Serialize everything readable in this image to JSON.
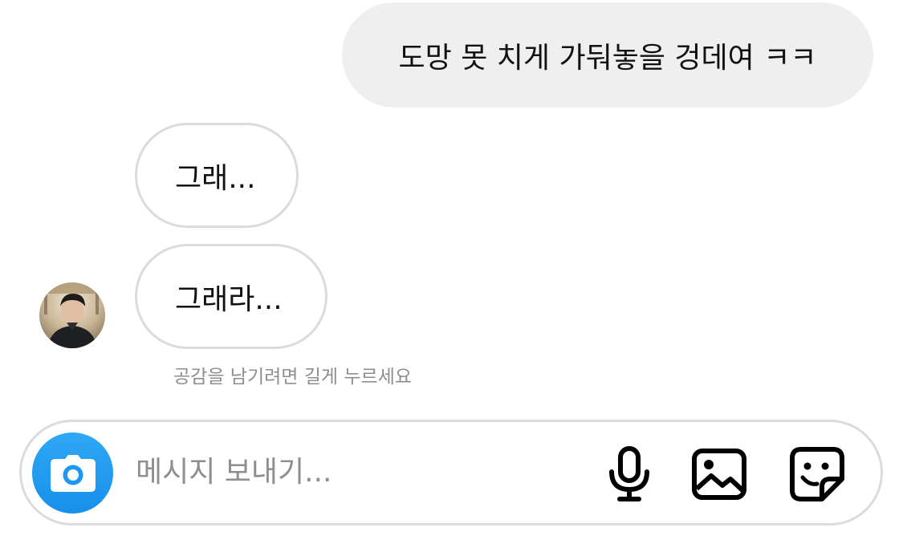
{
  "messages": {
    "outgoing": [
      {
        "text": "도망 못 치게 가둬놓을 겅데여 ㅋㅋ"
      }
    ],
    "incoming": [
      {
        "text": "그래..."
      },
      {
        "text": "그래라..."
      }
    ]
  },
  "reaction_hint": "공감을 남기려면 길게 누르세요",
  "composer": {
    "placeholder": "메시지 보내기...",
    "camera_icon": "camera-icon",
    "mic_icon": "microphone-icon",
    "gallery_icon": "image-gallery-icon",
    "sticker_icon": "sticker-icon",
    "accent_color": "#1e97ee"
  },
  "colors": {
    "outgoing_bubble": "#efefef",
    "incoming_border": "#dbdbdb",
    "hint_text": "#8e8e8e"
  }
}
